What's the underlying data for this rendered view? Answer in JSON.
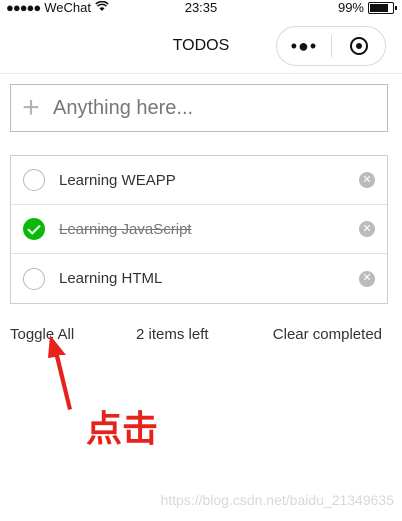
{
  "status_bar": {
    "signal": "●●●●●",
    "carrier": "WeChat",
    "wifi_icon": "wifi-icon",
    "time": "23:35",
    "battery": "99%"
  },
  "nav": {
    "title": "TODOS",
    "more_glyph": "•●•"
  },
  "header": {
    "placeholder": "Anything here...",
    "plus_glyph": "+"
  },
  "todos": [
    {
      "label": "Learning WEAPP",
      "completed": false
    },
    {
      "label": "Learning JavaScript",
      "completed": true
    },
    {
      "label": "Learning HTML",
      "completed": false
    }
  ],
  "footer": {
    "toggle_all": "Toggle All",
    "items_left": "2 items left",
    "clear_completed": "Clear completed"
  },
  "annotation": {
    "text": "点击",
    "color": "#e8221b"
  },
  "watermark": "https://blog.csdn.net/baidu_21349635",
  "colors": {
    "check_done": "#09bb07",
    "remove_icon": "#bbbbbb"
  }
}
